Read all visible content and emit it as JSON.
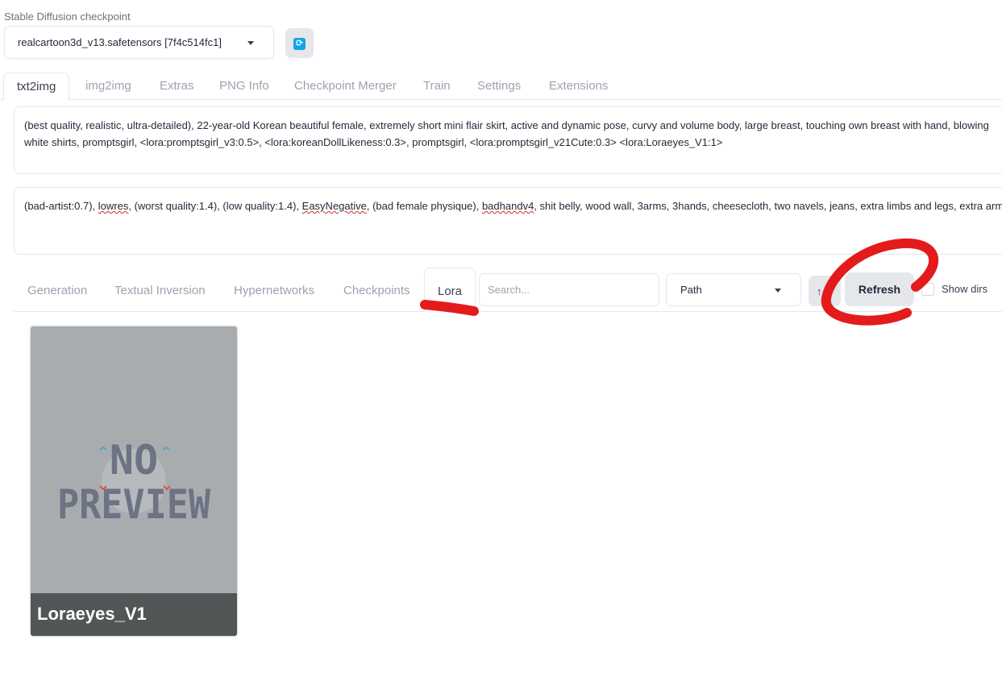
{
  "checkpoint": {
    "label": "Stable Diffusion checkpoint",
    "selected": "realcartoon3d_v13.safetensors [7f4c514fc1]",
    "refresh_icon": "refresh-icon"
  },
  "tabs": [
    {
      "label": "txt2img",
      "active": true
    },
    {
      "label": "img2img"
    },
    {
      "label": "Extras"
    },
    {
      "label": "PNG Info"
    },
    {
      "label": "Checkpoint Merger"
    },
    {
      "label": "Train"
    },
    {
      "label": "Settings"
    },
    {
      "label": "Extensions"
    }
  ],
  "prompt": {
    "line1": "(best quality, realistic, ultra-detailed), 22-year-old Korean beautiful female, extremely short mini flair skirt, active and dynamic pose, curvy and volume body, large breast, touching own breast with hand, blowing",
    "line2": "white shirts, promptsgirl, <lora:promptsgirl_v3:0.5>, <lora:koreanDollLikeness:0.3>, promptsgirl, <lora:promptsgirl_v21Cute:0.3> <lora:Loraeyes_V1:1>"
  },
  "negative_prompt": {
    "seg1": "(bad-artist:0.7), ",
    "seg2": "lowres",
    "seg3": ", (worst quality:1.4), (low quality:1.4), ",
    "seg4": "EasyNegative",
    "seg5": ", (bad female physique), ",
    "seg6": "badhandv4",
    "seg7": ", shit belly, wood wall, 3arms, 3hands, cheesecloth, two navels, jeans, extra limbs and legs, extra arm"
  },
  "extra_networks": {
    "tabs": [
      {
        "label": "Generation"
      },
      {
        "label": "Textual Inversion"
      },
      {
        "label": "Hypernetworks"
      },
      {
        "label": "Checkpoints"
      },
      {
        "label": "Lora",
        "active": true
      }
    ],
    "search_placeholder": "Search...",
    "sort_label": "Path",
    "sort_direction": "↑↓",
    "refresh_label": "Refresh",
    "show_dirs_label": "Show dirs",
    "show_dirs_checked": false
  },
  "cards": [
    {
      "name": "Loraeyes_V1",
      "preview_text_1": "NO",
      "preview_text_2": "PREVIEW"
    }
  ],
  "colors": {
    "annotation_red": "#e31b1b",
    "accent_blue": "#0ea5e9"
  }
}
